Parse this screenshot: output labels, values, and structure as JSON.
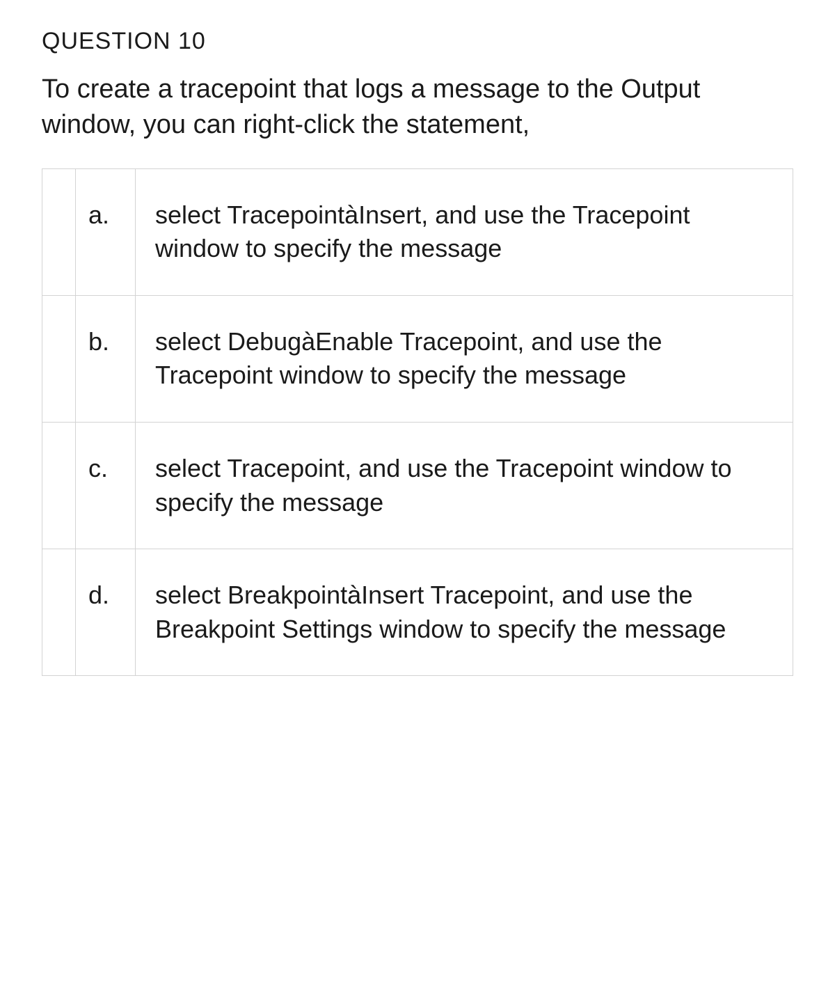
{
  "question": {
    "number": "QUESTION 10",
    "text": "To create a tracepoint that logs a message to the Output window, you can right-click the statement,"
  },
  "answers": [
    {
      "letter": "a.",
      "text": "select TracepointàInsert, and use the Tracepoint window to specify the message"
    },
    {
      "letter": "b.",
      "text": "select DebugàEnable Tracepoint, and use the Tracepoint window to specify the message"
    },
    {
      "letter": "c.",
      "text": "select Tracepoint, and use the Tracepoint window to specify the message"
    },
    {
      "letter": "d.",
      "text": "select BreakpointàInsert Tracepoint, and use the Breakpoint Settings window to specify the message"
    }
  ]
}
